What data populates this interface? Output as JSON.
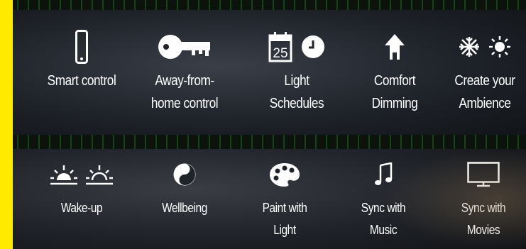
{
  "top_row": [
    {
      "label": "Smart control",
      "icon": "smartphone-icon"
    },
    {
      "label": "Away-from-\nhome control",
      "icon": "key-icon"
    },
    {
      "label": "Light\nSchedules",
      "icon": "calendar-clock-icon",
      "calendar_day": "25"
    },
    {
      "label": "Comfort\nDimming",
      "icon": "house-icon"
    },
    {
      "label": "Create your\nAmbience",
      "icon": "snowflake-sun-icon"
    }
  ],
  "bottom_row": [
    {
      "label": "Wake-up",
      "icon": "sunrise-icon"
    },
    {
      "label": "Wellbeing",
      "icon": "yin-yang-icon"
    },
    {
      "label": "Paint with\nLight",
      "icon": "palette-icon"
    },
    {
      "label": "Sync with\nMusic",
      "icon": "music-note-icon"
    },
    {
      "label": "Sync with\nMovies",
      "icon": "tv-icon"
    }
  ],
  "colors": {
    "accent_yellow": "#ffea00",
    "text": "#ffffff",
    "matrix_green": "#28a028"
  }
}
